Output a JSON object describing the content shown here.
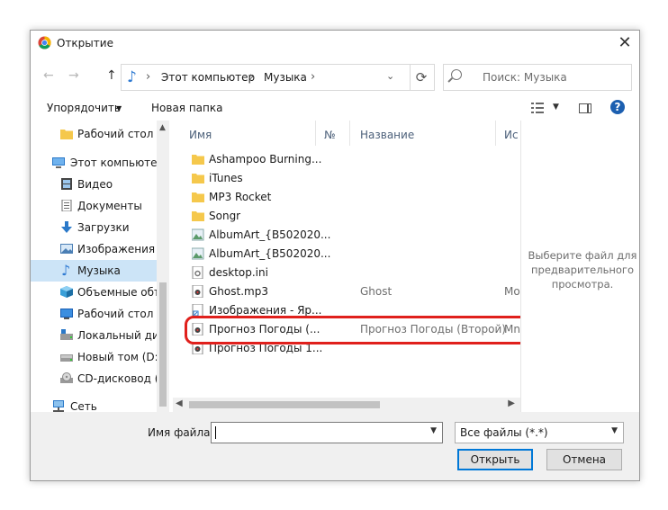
{
  "window": {
    "title": "Открытие",
    "close": "✕"
  },
  "navigation": {
    "back": "←",
    "forward": "→",
    "up": "↑",
    "breadcrumb": [
      "Этот компьютер",
      "Музыка"
    ],
    "refresh": "⟳",
    "search_placeholder": "Поиск: Музыка"
  },
  "toolbar": {
    "organize": "Упорядочить",
    "organize_caret": "▼",
    "new_folder": "Новая папка",
    "help": "?"
  },
  "sidebar": {
    "items": [
      {
        "label": "Рабочий стол",
        "icon": "folder-icon"
      },
      {
        "label": "Этот компьютер",
        "icon": "computer-icon"
      },
      {
        "label": "Видео",
        "icon": "video-icon"
      },
      {
        "label": "Документы",
        "icon": "documents-icon"
      },
      {
        "label": "Загрузки",
        "icon": "download-icon"
      },
      {
        "label": "Изображения",
        "icon": "pictures-icon"
      },
      {
        "label": "Музыка",
        "icon": "music-icon",
        "selected": true
      },
      {
        "label": "Объемные объ",
        "icon": "3d-objects-icon"
      },
      {
        "label": "Рабочий стол",
        "icon": "desktop-icon"
      },
      {
        "label": "Локальный дис",
        "icon": "local-disk-icon"
      },
      {
        "label": "Новый том (D:)",
        "icon": "drive-icon"
      },
      {
        "label": "CD-дисковод (F",
        "icon": "cd-drive-icon"
      },
      {
        "label": "Сеть",
        "icon": "network-icon"
      }
    ]
  },
  "file_list": {
    "columns": [
      "Имя",
      "№",
      "Название",
      "Ис"
    ],
    "rows": [
      {
        "name": "Ashampoo Burning...",
        "title": "",
        "extra": "",
        "icon": "folder-icon"
      },
      {
        "name": "iTunes",
        "title": "",
        "extra": "",
        "icon": "folder-icon"
      },
      {
        "name": "MP3 Rocket",
        "title": "",
        "extra": "",
        "icon": "folder-icon"
      },
      {
        "name": "Songr",
        "title": "",
        "extra": "",
        "icon": "folder-icon"
      },
      {
        "name": "AlbumArt_{B502020...",
        "title": "",
        "extra": "",
        "icon": "image-file-icon"
      },
      {
        "name": "AlbumArt_{B502020...",
        "title": "",
        "extra": "",
        "icon": "image-file-icon"
      },
      {
        "name": "desktop.ini",
        "title": "",
        "extra": "",
        "icon": "settings-file-icon"
      },
      {
        "name": "Ghost.mp3",
        "title": "Ghost",
        "extra": "Mo",
        "icon": "audio-file-icon"
      },
      {
        "name": "Изображения - Яр...",
        "title": "",
        "extra": "",
        "icon": "shortcut-icon"
      },
      {
        "name": "Прогноз Погоды (...",
        "title": "Прогноз Погоды (Второй)",
        "extra": "Mn",
        "icon": "audio-file-icon",
        "highlighted": true
      },
      {
        "name": "Прогноз Погоды 1...",
        "title": "",
        "extra": "",
        "icon": "audio-file-icon"
      }
    ]
  },
  "preview": {
    "message": "Выберите файл для предварительного просмотра."
  },
  "footer": {
    "filename_label": "Имя файла:",
    "filename_value": "",
    "filter_value": "Все файлы (*.*)",
    "open": "Открыть",
    "cancel": "Отмена"
  },
  "colors": {
    "selection": "#cce4f7",
    "highlight_ring": "#e0201c",
    "primary_border": "#0078d7",
    "folder": "#f5c84c"
  }
}
